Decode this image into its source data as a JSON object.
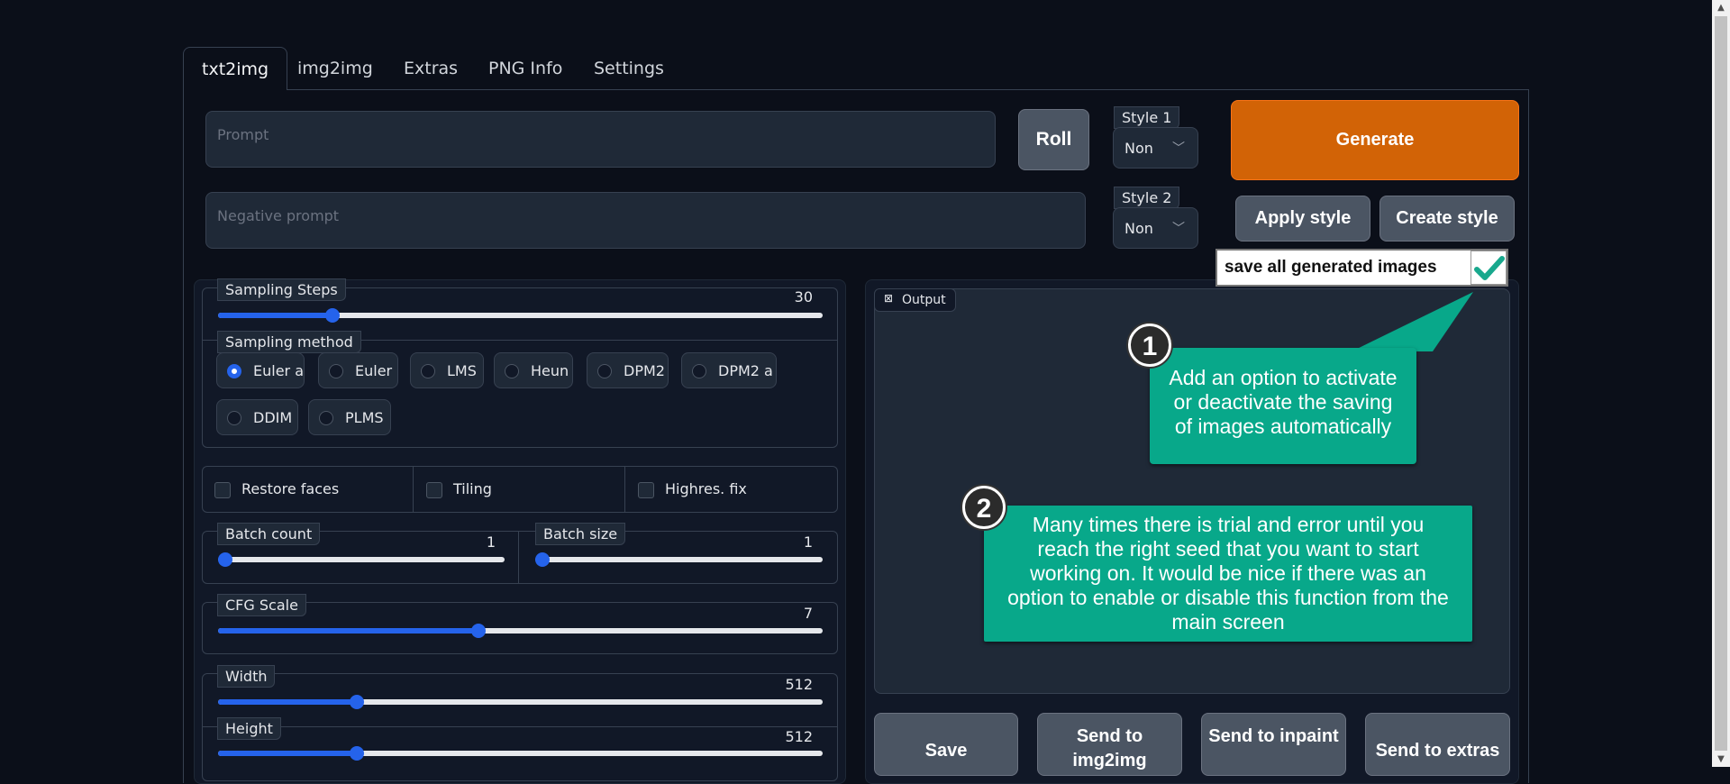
{
  "tabs": [
    "txt2img",
    "img2img",
    "Extras",
    "PNG Info",
    "Settings"
  ],
  "prompt": {
    "placeholder": "Prompt"
  },
  "negative_prompt": {
    "placeholder": "Negative prompt"
  },
  "roll_label": "Roll",
  "style1": {
    "label": "Style 1",
    "value": "Non"
  },
  "style2": {
    "label": "Style 2",
    "value": "Non"
  },
  "generate_label": "Generate",
  "apply_style_label": "Apply style",
  "create_style_label": "Create style",
  "save_toggle_label": "save all generated images",
  "sampling_steps": {
    "label": "Sampling Steps",
    "value": "30",
    "fraction": 0.19
  },
  "sampling_method": {
    "label": "Sampling method",
    "options": [
      "Euler a",
      "Euler",
      "LMS",
      "Heun",
      "DPM2",
      "DPM2 a",
      "DDIM",
      "PLMS"
    ],
    "selected": "Euler a"
  },
  "checkboxes": [
    "Restore faces",
    "Tiling",
    "Highres. fix"
  ],
  "batch_count": {
    "label": "Batch count",
    "value": "1",
    "fraction": 0.0
  },
  "batch_size": {
    "label": "Batch size",
    "value": "1",
    "fraction": 0.0
  },
  "cfg_scale": {
    "label": "CFG Scale",
    "value": "7",
    "fraction": 0.43
  },
  "width": {
    "label": "Width",
    "value": "512",
    "fraction": 0.23
  },
  "height": {
    "label": "Height",
    "value": "512",
    "fraction": 0.23
  },
  "output_label": "Output",
  "annotation1": {
    "number": "1",
    "text": "Add an option to activate or deactivate the saving of images automatically"
  },
  "annotation2": {
    "number": "2",
    "text": "Many times there is trial and error until you reach the right seed that you want to start working on. It would be nice if there was an option to enable or disable this function from the main screen"
  },
  "bottom_buttons": [
    "Save",
    "Send to img2img",
    "Send to inpaint",
    "Send to extras"
  ],
  "colors": {
    "accent": "#2563eb",
    "generate": "#d26306",
    "annotation": "#08a88a"
  }
}
